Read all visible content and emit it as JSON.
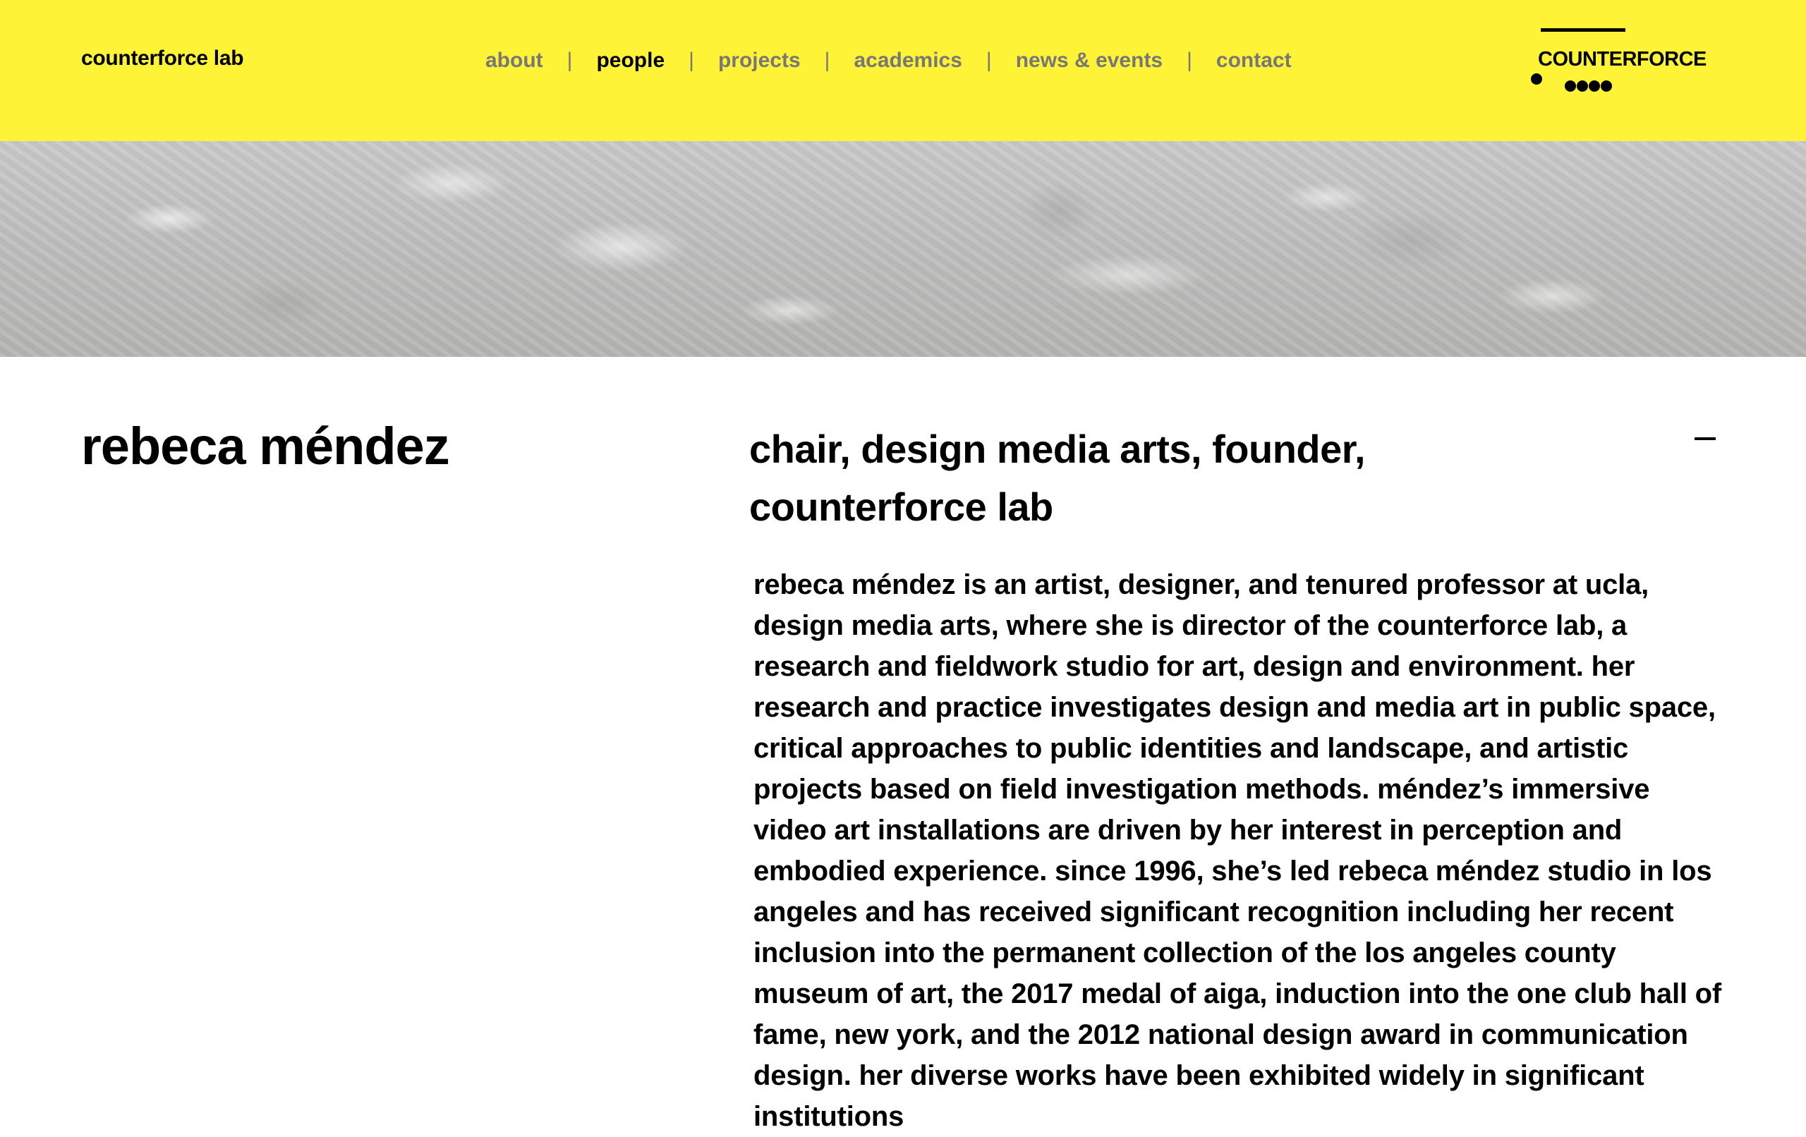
{
  "header": {
    "site_name": "counterforce lab",
    "nav": [
      {
        "label": "about",
        "active": false
      },
      {
        "label": "people",
        "active": true
      },
      {
        "label": "projects",
        "active": false
      },
      {
        "label": "academics",
        "active": false
      },
      {
        "label": "news & events",
        "active": false
      },
      {
        "label": "contact",
        "active": false
      }
    ],
    "separator": "|",
    "logo_text": "COUNTERFORCE"
  },
  "colors": {
    "header_background": "#fff338",
    "nav_inactive": "#777777",
    "text": "#000000"
  },
  "icons": {
    "collapse": "minus-icon"
  },
  "profile": {
    "name": "rebeca méndez",
    "role": "chair, design media arts, founder, counterforce lab",
    "bio": "rebeca méndez is an artist, designer, and tenured professor at ucla, design media arts, where she is director of the counterforce lab, a research and fieldwork studio for art, design and environment. her research and practice investigates design and media art in public space, critical approaches to public identities and landscape, and artistic projects based on field investigation methods. méndez’s immersive video art installations are driven by her interest in perception and embodied experience. since 1996, she’s led rebeca méndez studio in los angeles and has received significant recognition including her recent inclusion into the permanent collection of the los angeles county museum of art, the 2017 medal of aiga, induction into the one club hall of fame, new york, and the 2012 national design award in communication design. her diverse works have been exhibited widely in significant institutions"
  }
}
